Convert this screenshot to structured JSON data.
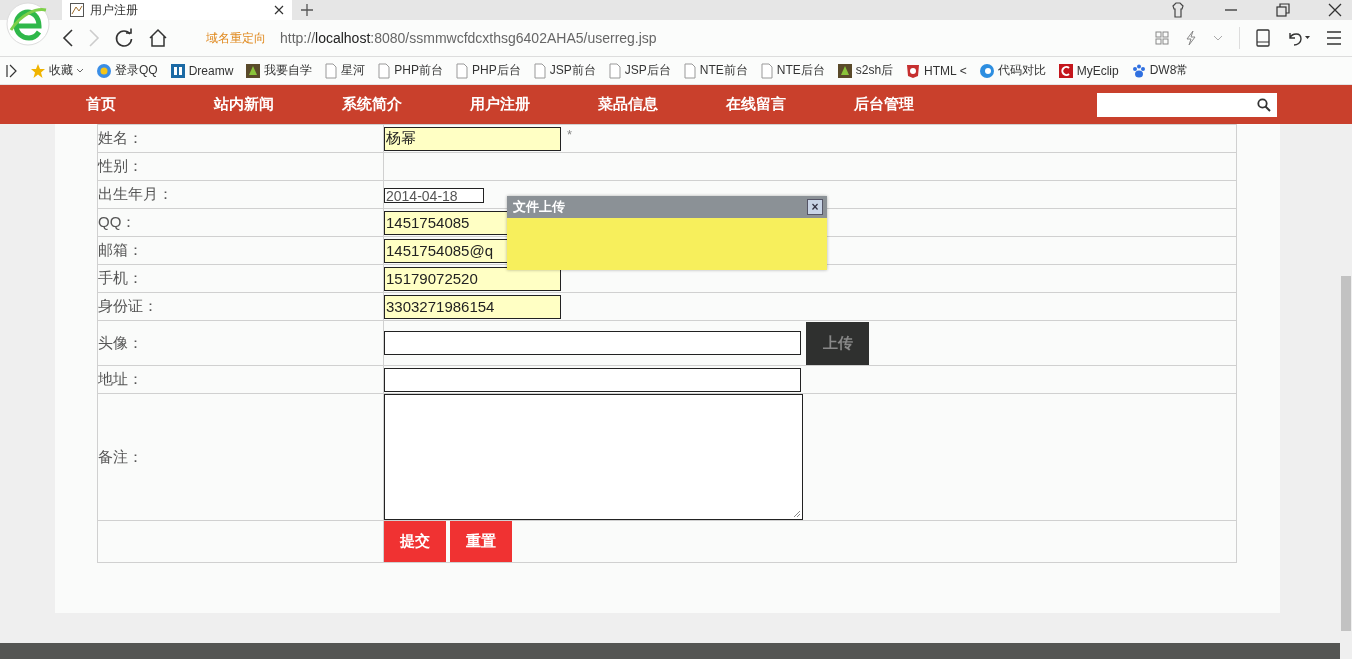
{
  "browser": {
    "tab": {
      "title": "用户注册"
    },
    "redirect_label": "域名重定向",
    "url": {
      "host_prefix": "http://",
      "host": "localhost",
      "rest": ":8080/ssmmwcfdcxthsg6402AHA5/userreg.jsp"
    },
    "bookmarks": [
      {
        "label": "收藏",
        "kind": "star"
      },
      {
        "label": "登录QQ",
        "kind": "qq"
      },
      {
        "label": "Dreamw",
        "kind": "dw"
      },
      {
        "label": "我要自学",
        "kind": "leaf"
      },
      {
        "label": "星河",
        "kind": "page"
      },
      {
        "label": "PHP前台",
        "kind": "page"
      },
      {
        "label": "PHP后台",
        "kind": "page"
      },
      {
        "label": "JSP前台",
        "kind": "page"
      },
      {
        "label": "JSP后台",
        "kind": "page"
      },
      {
        "label": "NTE前台",
        "kind": "page"
      },
      {
        "label": "NTE后台",
        "kind": "page"
      },
      {
        "label": "s2sh后",
        "kind": "leaf"
      },
      {
        "label": "HTML <",
        "kind": "h5"
      },
      {
        "label": "代码对比",
        "kind": "circle"
      },
      {
        "label": "MyEclip",
        "kind": "square"
      },
      {
        "label": "DW8常",
        "kind": "paw"
      }
    ]
  },
  "nav": {
    "items": [
      "首页",
      "站内新闻",
      "系统简介",
      "用户注册",
      "菜品信息",
      "在线留言",
      "后台管理"
    ]
  },
  "form": {
    "rows": [
      {
        "label": "姓名：",
        "kind": "text",
        "value": "杨幂",
        "note": "*"
      },
      {
        "label": "性别：",
        "kind": "empty"
      },
      {
        "label": "出生年月：",
        "kind": "date",
        "value": "2014-04-18"
      },
      {
        "label": "QQ：",
        "kind": "text",
        "value": "1451754085"
      },
      {
        "label": "邮箱：",
        "kind": "text",
        "value": "1451754085@q"
      },
      {
        "label": "手机：",
        "kind": "text",
        "value": "15179072520"
      },
      {
        "label": "身份证：",
        "kind": "text",
        "value": "3303271986154"
      },
      {
        "label": "头像：",
        "kind": "upload",
        "button": "上传"
      },
      {
        "label": "地址：",
        "kind": "wide"
      },
      {
        "label": "备注：",
        "kind": "textarea"
      }
    ],
    "buttons": [
      "提交",
      "重置"
    ]
  },
  "dialog": {
    "title": "文件上传",
    "close": "×"
  }
}
